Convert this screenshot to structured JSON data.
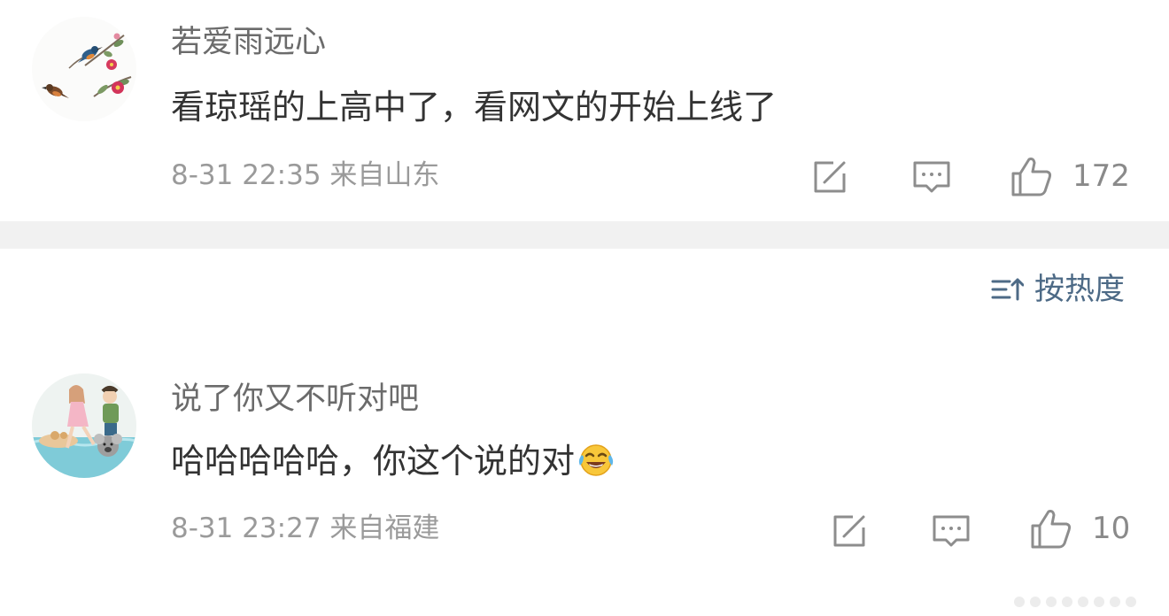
{
  "comments": [
    {
      "username": "若爱雨远心",
      "text": "看琼瑶的上高中了，看网文的开始上线了",
      "time": "8-31 22:35",
      "location": "来自山东",
      "likes": "172",
      "avatar": "bird-flower-painting"
    },
    {
      "username": "说了你又不听对吧",
      "text": "哈哈哈哈哈，你这个说的对",
      "emoji": "laughing-crying-emoji",
      "time": "8-31 23:27",
      "location": "来自福建",
      "likes": "10",
      "avatar": "cartoon-beach-couple"
    }
  ],
  "sort": {
    "label": "按热度",
    "icon": "sort-icon"
  },
  "icons": {
    "repost": "repost-icon",
    "reply": "comment-icon",
    "like": "thumbs-up-icon"
  },
  "colors": {
    "username": "#6b6b6b",
    "text": "#333333",
    "meta": "#9a9a9a",
    "sort": "#4d6a86",
    "divider": "#f1f1f1"
  }
}
